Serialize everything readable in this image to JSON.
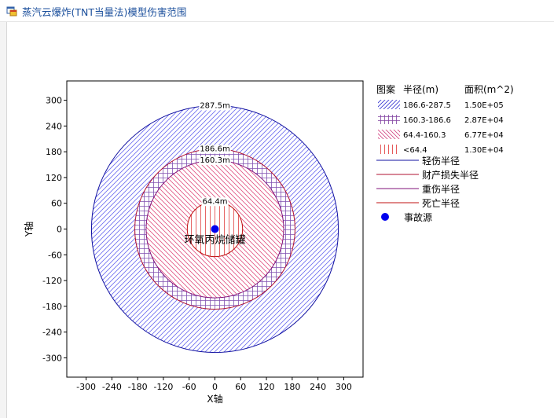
{
  "window": {
    "title": "蒸汽云爆炸(TNT当量法)模型伤害范围",
    "icon": "app-window-icon"
  },
  "chart_data": {
    "type": "circle-zones",
    "xlabel": "X轴",
    "ylabel": "Y轴",
    "xlim": [
      -345,
      345
    ],
    "ylim": [
      -345,
      345
    ],
    "xticks": [
      -300,
      -240,
      -180,
      -120,
      -60,
      0,
      60,
      120,
      180,
      240,
      300
    ],
    "yticks": [
      300,
      240,
      180,
      120,
      60,
      0,
      -60,
      -120,
      -180,
      -240,
      -300
    ],
    "circles": [
      {
        "radius": 287.5,
        "label": "287.5m",
        "color": "#1010a0",
        "hatch": "diag-forward",
        "hatch_color": "#6a6af0"
      },
      {
        "radius": 186.6,
        "label": "186.6m",
        "color": "#b01030",
        "hatch": "grid",
        "hatch_color": "#8050b0"
      },
      {
        "radius": 160.3,
        "label": "160.3m",
        "color": "#80107a",
        "hatch": "diag-back",
        "hatch_color": "#e05080"
      },
      {
        "radius": 64.4,
        "label": "64.4m",
        "color": "#c01010",
        "hatch": "vertical",
        "hatch_color": "#e04040"
      }
    ],
    "source": {
      "x": 0,
      "y": 0,
      "label": "环氧丙烷储罐",
      "color": "#0000ee"
    },
    "legend": {
      "headers": {
        "pattern": "图案",
        "radius": "半径(m)",
        "area": "面积(m^2)"
      },
      "rows": [
        {
          "hatch": "diag-forward",
          "color": "#3030d0",
          "radius": "186.6-287.5",
          "area": "1.50E+05"
        },
        {
          "hatch": "grid",
          "color": "#8040a0",
          "radius": "160.3-186.6",
          "area": "2.87E+04"
        },
        {
          "hatch": "diag-back",
          "color": "#d04080",
          "radius": "64.4-160.3",
          "area": "6.77E+04"
        },
        {
          "hatch": "vertical",
          "color": "#e03030",
          "radius": "<64.4",
          "area": "1.30E+04"
        }
      ],
      "lines": [
        {
          "label": "轻伤半径",
          "color": "#1010a0"
        },
        {
          "label": "财产损失半径",
          "color": "#b01030"
        },
        {
          "label": "重伤半径",
          "color": "#80107a"
        },
        {
          "label": "死亡半径",
          "color": "#c01010"
        }
      ],
      "source_label": "事故源",
      "source_color": "#0000ee"
    }
  }
}
